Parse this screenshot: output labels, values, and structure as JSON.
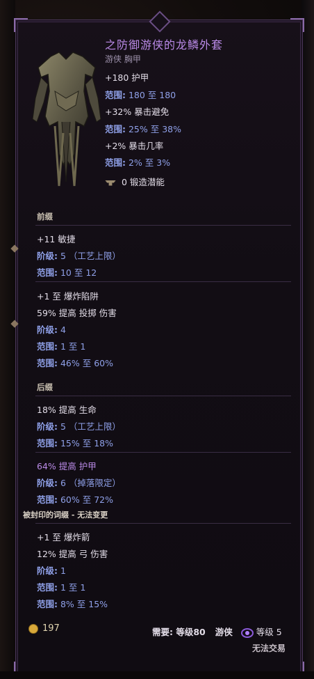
{
  "item": {
    "title": "之防御游侠的龙鳞外套",
    "subtitle": "游侠 胸甲",
    "base_stats": [
      {
        "text": "+180 护甲"
      },
      {
        "label": "范围:",
        "text": " 180 至 180"
      },
      {
        "text": "+32% 暴击避免"
      },
      {
        "label": "范围:",
        "text": " 25% 至 38%"
      },
      {
        "text": "+2% 暴击几率"
      },
      {
        "label": "范围:",
        "text": " 2% 至 3%"
      }
    ],
    "forge_potential": "0 锻造潜能"
  },
  "prefix": {
    "header": "前缀",
    "affix1": {
      "line1": "+11 敏捷",
      "tier_label": "阶级:",
      "tier_value": " 5 （工艺上限）",
      "range_label": "范围:",
      "range_value": " 10 至 12"
    },
    "affix2": {
      "line1": "+1 至 爆炸陷阱",
      "line2": "59% 提高 投掷 伤害",
      "tier_label": "阶级:",
      "tier_value": " 4",
      "range1_label": "范围:",
      "range1_value": " 1 至 1",
      "range2_label": "范围:",
      "range2_value": " 46% 至 60%"
    }
  },
  "suffix": {
    "header": "后缀",
    "affix1": {
      "line1": "18% 提高 生命",
      "tier_label": "阶级:",
      "tier_value": " 5 （工艺上限）",
      "range_label": "范围:",
      "range_value": " 15% 至 18%"
    },
    "affix2": {
      "line1": "64% 提高 护甲",
      "tier_label": "阶级:",
      "tier_value": " 6 （掉落限定）",
      "range_label": "范围:",
      "range_value": " 60% 至 72%"
    }
  },
  "sealed": {
    "header": "被封印的词缀 - 无法变更",
    "line1": "+1 至 爆炸箭",
    "line2": "12% 提高 弓 伤害",
    "tier_label": "阶级:",
    "tier_value": " 1",
    "range1_label": "范围:",
    "range1_value": " 1 至 1",
    "range2_label": "范围:",
    "range2_value": " 8% 至 15%"
  },
  "footer": {
    "gold": "197",
    "requires_label": "需要: 等级80",
    "class": "游侠",
    "level_label": "等级 5",
    "trade_status": "无法交易"
  },
  "colors": {
    "title": "#b98ae6",
    "stat_label": "#8fa0e8",
    "text": "#e3dde8",
    "border": "#4a3658"
  },
  "icons": [
    "armor-art",
    "anvil-icon",
    "gold-icon",
    "faction-eye-icon"
  ]
}
